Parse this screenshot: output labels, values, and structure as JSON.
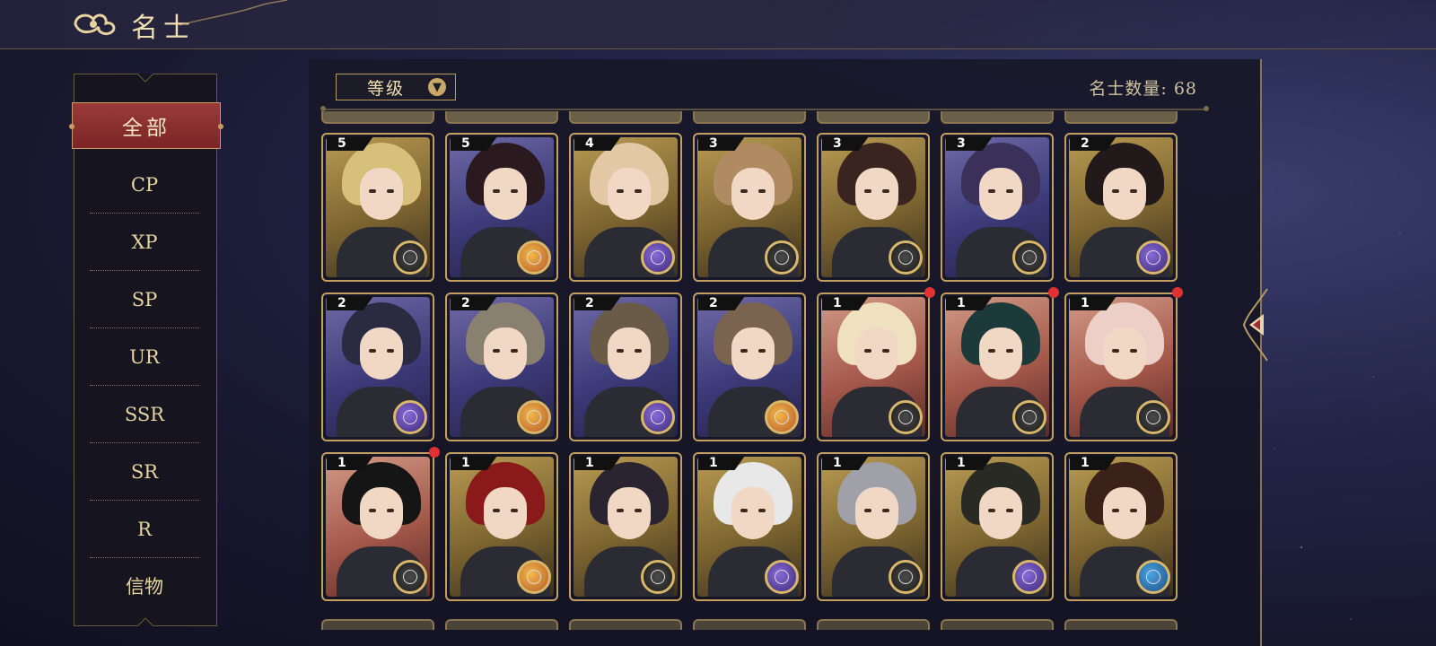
{
  "header": {
    "title": "名士"
  },
  "sidebar": {
    "active": "全部",
    "items": [
      "CP",
      "XP",
      "SP",
      "UR",
      "SSR",
      "SR",
      "R",
      "信物"
    ]
  },
  "toolbar": {
    "sort_label": "等级",
    "count_text": "名士数量: 68"
  },
  "colors": {
    "accent_gold": "#c4a060",
    "active_tab": "#8b2d2e",
    "panel": "#18182a"
  },
  "cards": [
    {
      "level": "5",
      "bg": "gold",
      "hair": "#d7c07a",
      "orb": "compass",
      "dot": false
    },
    {
      "level": "5",
      "bg": "purple",
      "hair": "#2a1a20",
      "orb": "planet-orange",
      "dot": false
    },
    {
      "level": "4",
      "bg": "gold",
      "hair": "#e2c8a4",
      "orb": "planet-purple",
      "dot": false
    },
    {
      "level": "3",
      "bg": "gold",
      "hair": "#b08a60",
      "orb": "compass",
      "dot": false
    },
    {
      "level": "3",
      "bg": "gold",
      "hair": "#3a2420",
      "orb": "compass",
      "dot": false
    },
    {
      "level": "3",
      "bg": "purple",
      "hair": "#3a305a",
      "orb": "compass",
      "dot": false
    },
    {
      "level": "2",
      "bg": "gold",
      "hair": "#221a1a",
      "orb": "planet-purple",
      "dot": false
    },
    {
      "level": "2",
      "bg": "purple",
      "hair": "#2a2a40",
      "orb": "planet-purple",
      "dot": false
    },
    {
      "level": "2",
      "bg": "purple",
      "hair": "#8a8070",
      "orb": "planet-orange",
      "dot": false
    },
    {
      "level": "2",
      "bg": "purple",
      "hair": "#6a5a48",
      "orb": "planet-purple",
      "dot": false
    },
    {
      "level": "2",
      "bg": "purple",
      "hair": "#7a6450",
      "orb": "planet-orange",
      "dot": false
    },
    {
      "level": "1",
      "bg": "red",
      "hair": "#efe0c0",
      "orb": "compass",
      "dot": true
    },
    {
      "level": "1",
      "bg": "red",
      "hair": "#1c3a3a",
      "orb": "compass",
      "dot": true
    },
    {
      "level": "1",
      "bg": "red",
      "hair": "#ecd0c8",
      "orb": "compass",
      "dot": true
    },
    {
      "level": "1",
      "bg": "red",
      "hair": "#151515",
      "orb": "compass",
      "dot": true
    },
    {
      "level": "1",
      "bg": "gold",
      "hair": "#8a1a1a",
      "orb": "planet-orange",
      "dot": false
    },
    {
      "level": "1",
      "bg": "gold",
      "hair": "#2a2430",
      "orb": "compass",
      "dot": false
    },
    {
      "level": "1",
      "bg": "gold",
      "hair": "#e8e8e8",
      "orb": "planet-purple",
      "dot": false
    },
    {
      "level": "1",
      "bg": "gold",
      "hair": "#a0a0a8",
      "orb": "compass",
      "dot": false
    },
    {
      "level": "1",
      "bg": "gold",
      "hair": "#2a2a24",
      "orb": "planet-purple",
      "dot": false
    },
    {
      "level": "1",
      "bg": "gold",
      "hair": "#3a2218",
      "orb": "planet-blue",
      "dot": false
    }
  ]
}
